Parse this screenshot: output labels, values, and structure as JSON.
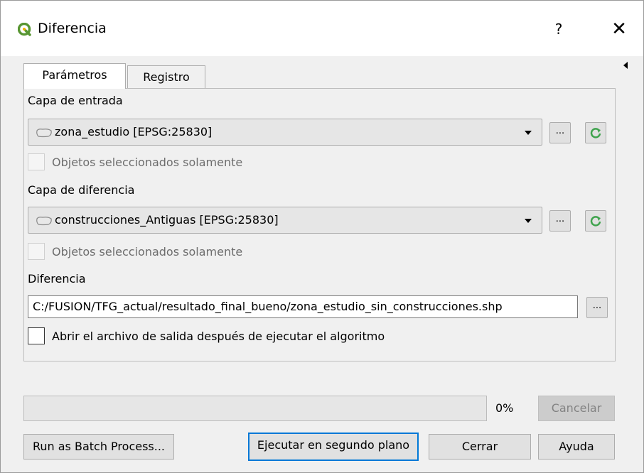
{
  "window": {
    "title": "Diferencia",
    "help_label": "?",
    "close_label": "✕"
  },
  "tabs": [
    {
      "label": "Parámetros",
      "active": true
    },
    {
      "label": "Registro",
      "active": false
    }
  ],
  "params": {
    "input_layer": {
      "label": "Capa de entrada",
      "value": "zona_estudio [EPSG:25830]",
      "selected_only_label": "Objetos seleccionados solamente"
    },
    "diff_layer": {
      "label": "Capa de diferencia",
      "value": "construcciones_Antiguas [EPSG:25830]",
      "selected_only_label": "Objetos seleccionados solamente"
    },
    "output": {
      "label": "Diferencia",
      "value": "C:/FUSION/TFG_actual/resultado_final_bueno/zona_estudio_sin_construcciones.shp",
      "open_after_label": "Abrir el archivo de salida después de ejecutar el algoritmo"
    },
    "browse_label": "..."
  },
  "progress": {
    "value": 0,
    "text": "0%"
  },
  "buttons": {
    "cancel": "Cancelar",
    "batch": "Run as Batch Process...",
    "run_background": "Ejecutar en segundo plano",
    "close": "Cerrar",
    "help": "Ayuda"
  },
  "colors": {
    "accent": "#0078d7",
    "qgis_green": "#589632",
    "sync_green": "#3fa34d"
  }
}
